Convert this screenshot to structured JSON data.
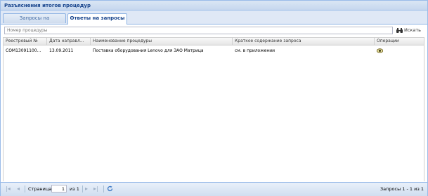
{
  "panel": {
    "title": "Разъяснения итогов процедур"
  },
  "tabs": [
    {
      "label": "Запросы на разъяснение",
      "active": false
    },
    {
      "label": "Ответы на запросы",
      "active": true
    }
  ],
  "search": {
    "placeholder": "Номер процедуры",
    "button_label": "Искать",
    "button_icon": "binoculars-icon"
  },
  "grid": {
    "columns": [
      "Реестровый №",
      "Дата направл...",
      "Наименование процедуры",
      "Краткое содержание запроса",
      "Операции"
    ],
    "rows": [
      {
        "registry_no": "COM13091100...",
        "date": "13.09.2011",
        "procedure_name": "Поставка оборудования Lenovo для ЗАО Матрица",
        "summary": "см. в приложении",
        "operation_icon": "view-eye-icon"
      }
    ]
  },
  "pager": {
    "page_label": "Страница",
    "page_value": "1",
    "of_label": "из 1",
    "status": "Запросы 1 - 1 из 1"
  }
}
